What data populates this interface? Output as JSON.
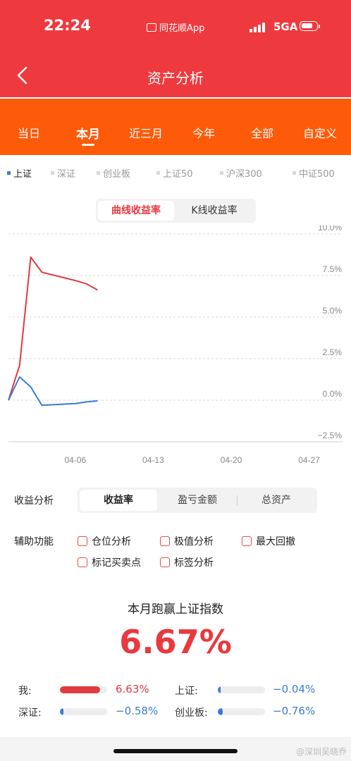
{
  "status_bar": {
    "time": "22:24",
    "app_label": "同花顺App",
    "network": "5GA"
  },
  "header": {
    "title": "资产分析",
    "back_icon": "chevron-left-icon"
  },
  "period_tabs": {
    "items": [
      "当日",
      "本月",
      "近三月",
      "今年",
      "全部",
      "自定义"
    ],
    "active": "本月"
  },
  "compare_series": {
    "items": [
      "上证",
      "深证",
      "创业板",
      "上证50",
      "沪深300",
      "中证500"
    ],
    "active": "上证"
  },
  "chart_toggle": {
    "options": [
      "曲线收益率",
      "K线收益率"
    ],
    "active": "曲线收益率"
  },
  "chart_data": {
    "type": "line",
    "x_tick_labels": [
      "04-06",
      "04-13",
      "04-20",
      "04-27"
    ],
    "y_tick_labels": [
      "10.0%",
      "7.5%",
      "5.0%",
      "2.5%",
      "0.0%",
      "−2.5%"
    ],
    "ylim": [
      -2.5,
      10.0
    ],
    "grid": true,
    "series": [
      {
        "color": "#e03a3e",
        "x": [
          "03-31",
          "04-01",
          "04-02",
          "04-03",
          "04-06",
          "04-07",
          "04-08"
        ],
        "values": [
          0.0,
          2.1,
          8.6,
          7.7,
          7.2,
          7.0,
          6.63
        ]
      },
      {
        "color": "#3a7bd5",
        "x": [
          "03-31",
          "04-01",
          "04-02",
          "04-03",
          "04-06",
          "04-07",
          "04-08"
        ],
        "values": [
          0.0,
          1.4,
          0.8,
          -0.3,
          -0.2,
          -0.1,
          -0.04
        ]
      }
    ]
  },
  "analysis": {
    "label": "收益分析",
    "options": [
      "收益率",
      "盈亏金额",
      "总资产"
    ],
    "active": "收益率"
  },
  "aux": {
    "label": "辅助功能",
    "options": [
      "仓位分析",
      "极值分析",
      "最大回撤",
      "标记买卖点",
      "标签分析"
    ]
  },
  "beat": {
    "title": "本月跑赢上证指数",
    "value": "6.67%"
  },
  "comparison": [
    {
      "label": "我:",
      "value": "6.63%",
      "fill": 0.85,
      "color": "#e03a3e"
    },
    {
      "label": "上证:",
      "value": "−0.04%",
      "fill": 0.02,
      "color": "#3a7bd5"
    },
    {
      "label": "深证:",
      "value": "−0.58%",
      "fill": 0.08,
      "color": "#3a7bd5"
    },
    {
      "label": "创业板:",
      "value": "−0.76%",
      "fill": 0.1,
      "color": "#3a7bd5"
    }
  ],
  "watermark": "@深圳吴晓乔",
  "colors": {
    "header_red": "#ee3a3f",
    "tab_orange": "#fd5a0a",
    "accent_red": "#e8393e",
    "accent_blue": "#3a7bd5"
  }
}
